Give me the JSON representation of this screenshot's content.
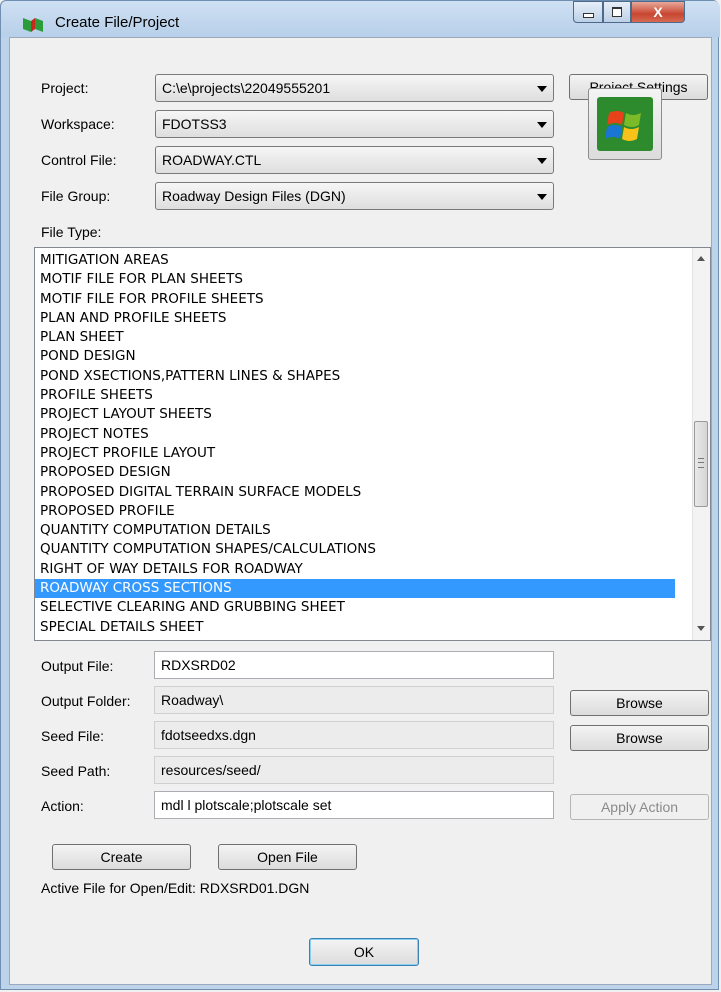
{
  "window": {
    "title": "Create File/Project",
    "buttons": {
      "minimize": "minimize",
      "maximize": "maximize",
      "close": "X"
    }
  },
  "form": {
    "project": {
      "label": "Project:",
      "value": "C:\\e\\projects\\22049555201"
    },
    "workspace": {
      "label": "Workspace:",
      "value": "FDOTSS3"
    },
    "control_file": {
      "label": "Control File:",
      "value": "ROADWAY.CTL"
    },
    "file_group": {
      "label": "File Group:",
      "value": "Roadway Design Files (DGN)"
    },
    "project_settings_label": "Project Settings",
    "file_type_label": "File Type:"
  },
  "file_types": [
    "MITIGATION AREAS",
    "MOTIF FILE FOR PLAN SHEETS",
    "MOTIF FILE FOR PROFILE SHEETS",
    "PLAN AND PROFILE SHEETS",
    "PLAN SHEET",
    "POND DESIGN",
    "POND XSECTIONS,PATTERN LINES & SHAPES",
    "PROFILE SHEETS",
    "PROJECT LAYOUT SHEETS",
    "PROJECT NOTES",
    "PROJECT PROFILE LAYOUT",
    "PROPOSED DESIGN",
    "PROPOSED DIGITAL TERRAIN SURFACE MODELS",
    "PROPOSED PROFILE",
    "QUANTITY COMPUTATION DETAILS",
    "QUANTITY COMPUTATION SHAPES/CALCULATIONS",
    "RIGHT OF WAY DETAILS FOR ROADWAY",
    "ROADWAY CROSS SECTIONS",
    "SELECTIVE CLEARING AND GRUBBING SHEET",
    "SPECIAL DETAILS SHEET"
  ],
  "selected_file_type": "ROADWAY CROSS SECTIONS",
  "output": {
    "output_file": {
      "label": "Output File:",
      "value": "RDXSRD02"
    },
    "output_folder": {
      "label": "Output Folder:",
      "value": "Roadway\\"
    },
    "seed_file": {
      "label": "Seed File:",
      "value": "fdotseedxs.dgn"
    },
    "seed_path": {
      "label": "Seed Path:",
      "value": "resources/seed/"
    },
    "action": {
      "label": "Action:",
      "value": "mdl l plotscale;plotscale set"
    },
    "browse1_label": "Browse",
    "browse2_label": "Browse",
    "apply_action_label": "Apply Action"
  },
  "footer": {
    "create_label": "Create",
    "open_file_label": "Open File",
    "active_file_text": "Active File for Open/Edit:  RDXSRD01.DGN",
    "ok_label": "OK"
  },
  "colors": {
    "selection": "#3399ff",
    "titlebar": "#b7cfe9",
    "close_button": "#c74631"
  }
}
